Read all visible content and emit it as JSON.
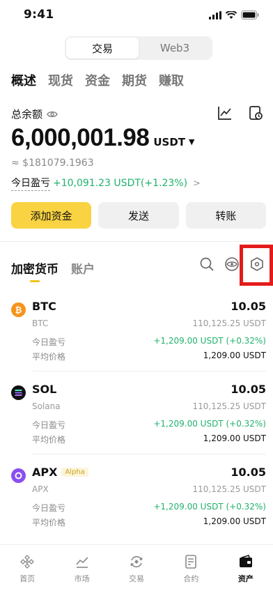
{
  "status": {
    "time": "9:41"
  },
  "segment": {
    "items": [
      "交易",
      "Web3"
    ]
  },
  "main_tabs": [
    "概述",
    "现货",
    "资金",
    "期货",
    "赚取"
  ],
  "balance": {
    "label": "总余额",
    "value": "6,000,001.98",
    "currency": "USDT",
    "approx": "≈ $181079.1963",
    "pnl_label": "今日盈亏",
    "pnl_value": "+10,091.23 USDT(+1.23%)"
  },
  "actions": {
    "add_funds": "添加资金",
    "send": "发送",
    "transfer": "转账"
  },
  "list_tabs": [
    "加密货币",
    "账户"
  ],
  "assets": [
    {
      "symbol": "BTC",
      "name": "BTC",
      "quantity": "10.05",
      "usd": "110,125.25 USDT",
      "pnl_label": "今日盈亏",
      "pnl": "+1,209.00 USDT (+0.32%)",
      "avg_label": "平均价格",
      "avg": "1,209.00 USDT",
      "color": "#f7931a",
      "badge": ""
    },
    {
      "symbol": "SOL",
      "name": "Solana",
      "quantity": "10.05",
      "usd": "110,125.25 USDT",
      "pnl_label": "今日盈亏",
      "pnl": "+1,209.00 USDT (+0.32%)",
      "avg_label": "平均价格",
      "avg": "1,209.00 USDT",
      "color": "#111111",
      "badge": ""
    },
    {
      "symbol": "APX",
      "name": "APX",
      "quantity": "10.05",
      "usd": "110,125.25 USDT",
      "pnl_label": "今日盈亏",
      "pnl": "+1,209.00 USDT (+0.32%)",
      "avg_label": "平均价格",
      "avg": "1,209.00 USDT",
      "color": "#8b4ef0",
      "badge": "Alpha"
    }
  ],
  "bottom_nav": [
    {
      "label": "首页",
      "icon": "home-icon"
    },
    {
      "label": "市场",
      "icon": "market-icon"
    },
    {
      "label": "交易",
      "icon": "trade-icon"
    },
    {
      "label": "合约",
      "icon": "contract-icon"
    },
    {
      "label": "资产",
      "icon": "wallet-icon"
    }
  ],
  "colors": {
    "accent": "#f9d342",
    "positive": "#20b26c",
    "highlight": "#e31b1b"
  }
}
